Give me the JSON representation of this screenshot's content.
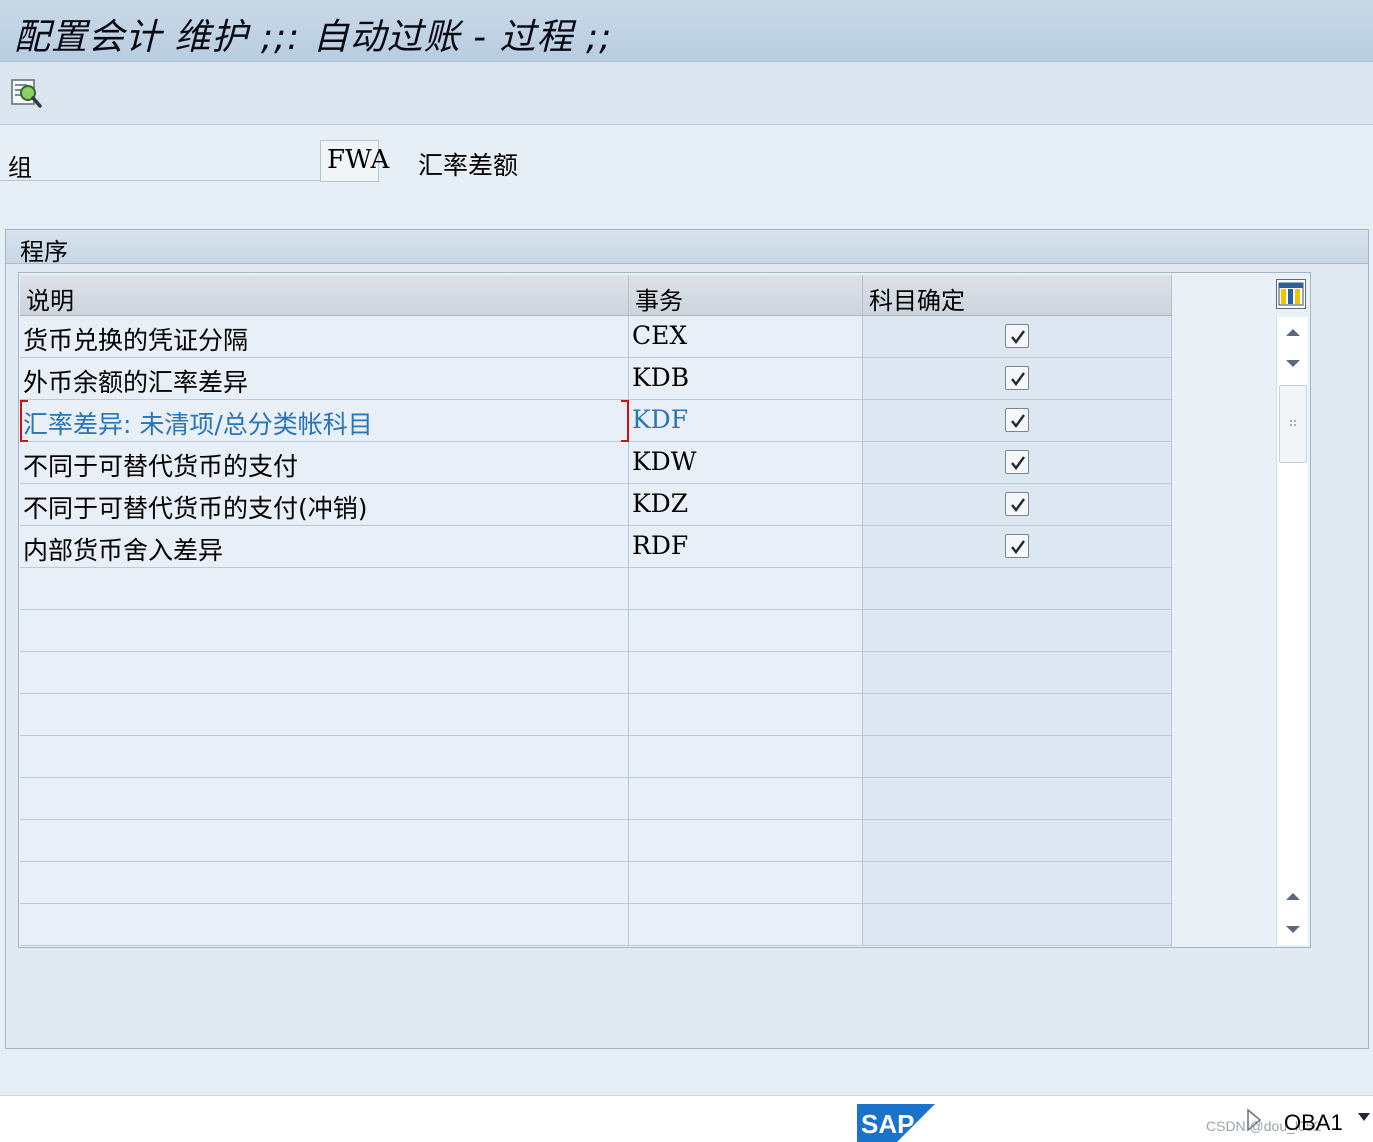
{
  "window": {
    "title": "配置会计 维护 ;;: 自动过账 - 过程 ;;"
  },
  "toolbar": {
    "buttons": [
      {
        "icon": "display-detail-icon"
      }
    ]
  },
  "group": {
    "label": "组",
    "value": "FWA",
    "description": "汇率差额"
  },
  "procedures": {
    "title": "程序",
    "columns": [
      "说明",
      "事务",
      "科目确定"
    ],
    "rows": [
      {
        "description": "货币兑换的凭证分隔",
        "transaction": "CEX",
        "account_determination": true
      },
      {
        "description": "外币余额的汇率差异",
        "transaction": "KDB",
        "account_determination": true
      },
      {
        "description": "汇率差异: 未清项/总分类帐科目",
        "transaction": "KDF",
        "account_determination": true,
        "selected": true
      },
      {
        "description": "不同于可替代货币的支付",
        "transaction": "KDW",
        "account_determination": true
      },
      {
        "description": "不同于可替代货币的支付(冲销)",
        "transaction": "KDZ",
        "account_determination": true
      },
      {
        "description": "内部货币舍入差异",
        "transaction": "RDF",
        "account_determination": true
      }
    ],
    "empty_rows": 9
  },
  "statusbar": {
    "logo_text": "SAP",
    "transaction_code": "OBA1",
    "watermark": "CSDN @dou_l052"
  },
  "colors": {
    "selected_text": "#2a74b8",
    "selection_bracket": "#d01010",
    "sap_blue": "#1a73c9"
  }
}
